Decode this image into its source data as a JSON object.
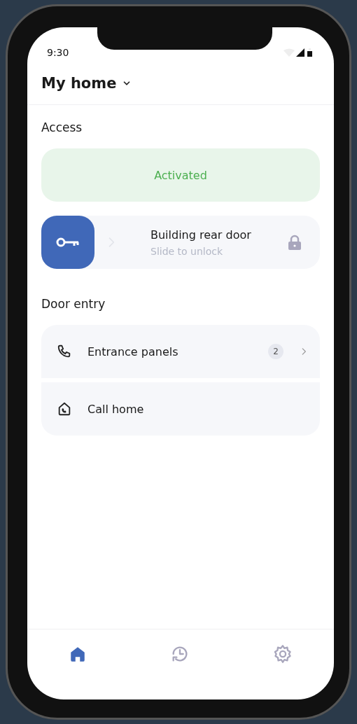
{
  "status_bar": {
    "time": "9:30"
  },
  "header": {
    "title": "My home"
  },
  "access": {
    "title": "Access",
    "status": "Activated",
    "active": true,
    "door": {
      "name": "Building rear door",
      "hint": "Slide to unlock",
      "locked": true
    }
  },
  "door_entry": {
    "title": "Door entry",
    "items": [
      {
        "kind": "phone",
        "label": "Entrance panels",
        "badge": "2",
        "chevron": true
      },
      {
        "kind": "home-phone",
        "label": "Call home",
        "chevron": false
      }
    ]
  },
  "tabs": [
    {
      "kind": "home",
      "selected": true
    },
    {
      "kind": "history",
      "selected": false
    },
    {
      "kind": "settings",
      "selected": false
    }
  ]
}
